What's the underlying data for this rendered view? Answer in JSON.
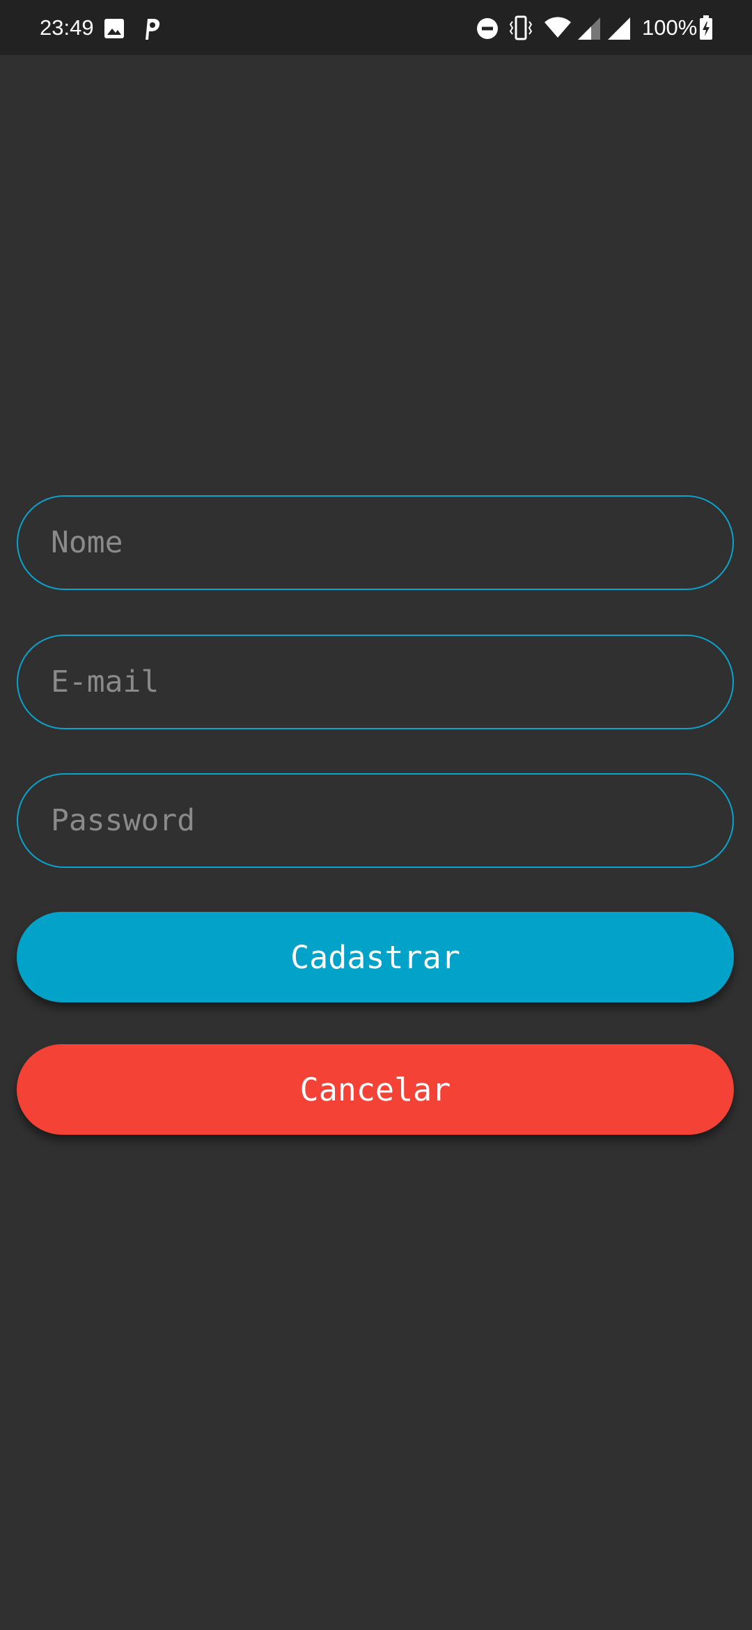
{
  "status_bar": {
    "time": "23:49",
    "battery": "100%",
    "icons": [
      "image-icon",
      "parking-app-icon",
      "do-not-disturb-icon",
      "vibrate-icon",
      "wifi-icon",
      "signal-icon",
      "signal-icon",
      "battery-charging-icon"
    ]
  },
  "form": {
    "name_placeholder": "Nome",
    "name_value": "",
    "email_placeholder": "E-mail",
    "email_value": "",
    "password_placeholder": "Password",
    "password_value": ""
  },
  "actions": {
    "register_label": "Cadastrar",
    "cancel_label": "Cancelar"
  },
  "colors": {
    "background": "#303030",
    "status_bar": "#222222",
    "field_border": "#0aa3cc",
    "primary": "#03a2c9",
    "danger": "#f44336"
  }
}
